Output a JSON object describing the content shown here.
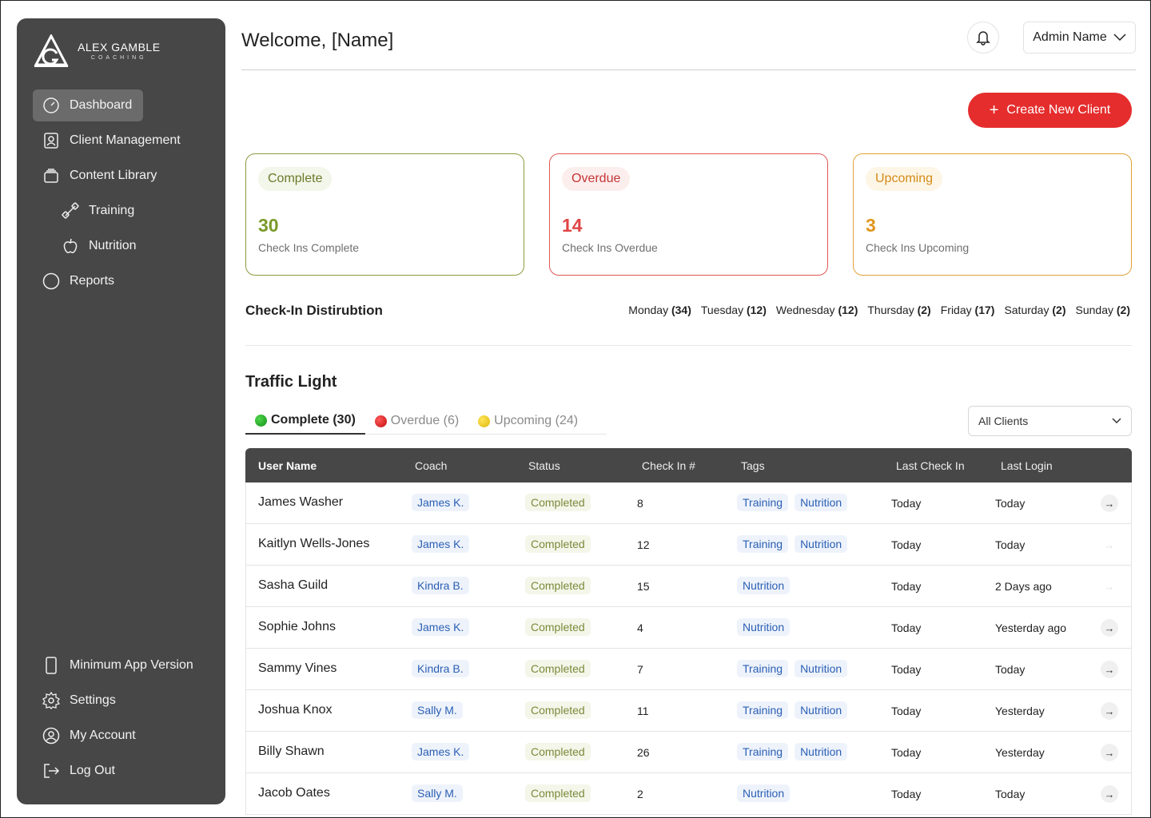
{
  "brand": {
    "title": "ALEX GAMBLE",
    "subtitle": "COACHING"
  },
  "sidebar": {
    "items": [
      {
        "label": "Dashboard",
        "icon": "gauge-icon",
        "active": true
      },
      {
        "label": "Client Management",
        "icon": "user-card-icon"
      },
      {
        "label": "Content Library",
        "icon": "library-icon"
      },
      {
        "label": "Training",
        "icon": "dumbbell-icon"
      },
      {
        "label": "Nutrition",
        "icon": "apple-icon"
      },
      {
        "label": "Reports",
        "icon": "circle-icon"
      }
    ],
    "bottom": [
      {
        "label": "Minimum App Version",
        "icon": "phone-icon"
      },
      {
        "label": "Settings",
        "icon": "gear-icon"
      },
      {
        "label": "My Account",
        "icon": "account-icon"
      },
      {
        "label": "Log Out",
        "icon": "logout-icon"
      }
    ]
  },
  "header": {
    "welcome": "Welcome, [Name]",
    "admin": "Admin Name"
  },
  "actions": {
    "create": "Create New Client"
  },
  "cards": [
    {
      "pill": "Complete",
      "number": "30",
      "label": "Check Ins Complete"
    },
    {
      "pill": "Overdue",
      "number": "14",
      "label": "Check Ins Overdue"
    },
    {
      "pill": "Upcoming",
      "number": "3",
      "label": "Check Ins Upcoming"
    }
  ],
  "distribution": {
    "title": "Check-In Distirubtion",
    "days": [
      {
        "day": "Monday",
        "count": "(34)"
      },
      {
        "day": "Tuesday",
        "count": "(12)"
      },
      {
        "day": "Wednesday",
        "count": "(12)"
      },
      {
        "day": "Thursday",
        "count": "(2)"
      },
      {
        "day": "Friday",
        "count": "(17)"
      },
      {
        "day": "Saturday",
        "count": "(2)"
      },
      {
        "day": "Sunday",
        "count": "(2)"
      }
    ]
  },
  "traffic": {
    "title": "Traffic Light",
    "tabs": [
      "Complete (30)",
      "Overdue (6)",
      "Upcoming (24)"
    ],
    "filter": "All Clients"
  },
  "table": {
    "headers": [
      "User Name",
      "Coach",
      "Status",
      "Check In #",
      "Tags",
      "Last Check In",
      "Last Login"
    ],
    "rows": [
      {
        "name": "James Washer",
        "coach": "James K.",
        "status": "Completed",
        "check": "8",
        "tags": [
          "Training",
          "Nutrition"
        ],
        "last": "Today",
        "login": "Today"
      },
      {
        "name": "Kaitlyn Wells-Jones",
        "coach": "James K.",
        "status": "Completed",
        "check": "12",
        "tags": [
          "Training",
          "Nutrition"
        ],
        "last": "Today",
        "login": "Today"
      },
      {
        "name": "Sasha Guild",
        "coach": "Kindra B.",
        "status": "Completed",
        "check": "15",
        "tags": [
          "Nutrition"
        ],
        "last": "Today",
        "login": "2 Days ago"
      },
      {
        "name": "Sophie Johns",
        "coach": "James K.",
        "status": "Completed",
        "check": "4",
        "tags": [
          "Nutrition"
        ],
        "last": "Today",
        "login": "Yesterday ago"
      },
      {
        "name": "Sammy Vines",
        "coach": "Kindra B.",
        "status": "Completed",
        "check": "7",
        "tags": [
          "Training",
          "Nutrition"
        ],
        "last": "Today",
        "login": "Today"
      },
      {
        "name": "Joshua Knox",
        "coach": "Sally M.",
        "status": "Completed",
        "check": "11",
        "tags": [
          "Training",
          "Nutrition"
        ],
        "last": "Today",
        "login": "Yesterday"
      },
      {
        "name": "Billy Shawn",
        "coach": "James K.",
        "status": "Completed",
        "check": "26",
        "tags": [
          "Training",
          "Nutrition"
        ],
        "last": "Today",
        "login": "Yesterday"
      },
      {
        "name": "Jacob Oates",
        "coach": "Sally M.",
        "status": "Completed",
        "check": "2",
        "tags": [
          "Nutrition"
        ],
        "last": "Today",
        "login": "Today"
      }
    ]
  },
  "colors": {
    "accent": "#e52d2d",
    "sidebar": "#474747",
    "complete": "#7a9a2a",
    "overdue": "#e04545",
    "upcoming": "#e0951d"
  }
}
